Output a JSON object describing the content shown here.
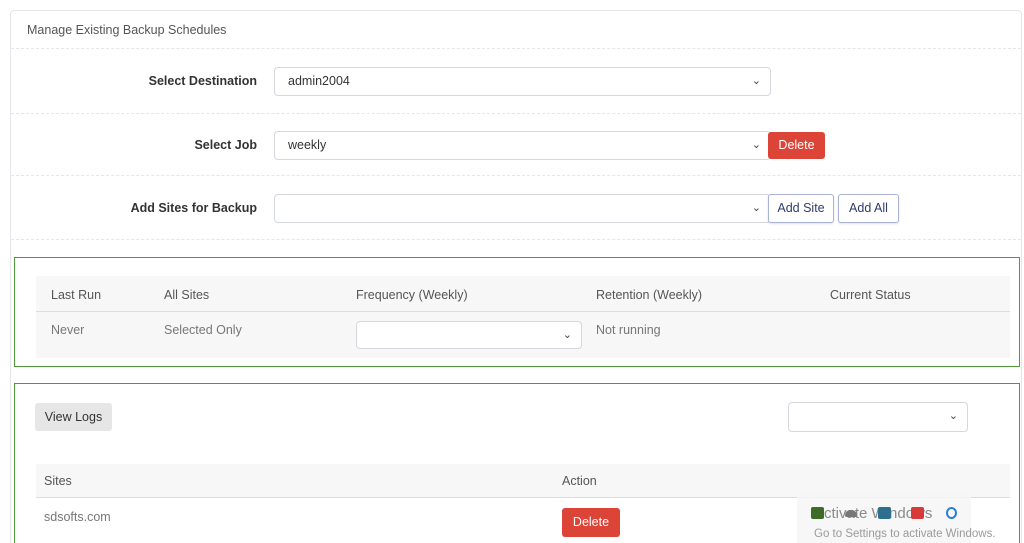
{
  "card": {
    "title": "Manage Existing Backup Schedules"
  },
  "destination": {
    "label": "Select Destination",
    "value": "admin2004"
  },
  "job": {
    "label": "Select Job",
    "value": "weekly",
    "delete_label": "Delete"
  },
  "sites": {
    "label": "Add Sites for Backup",
    "value": "",
    "add_site_label": "Add Site",
    "add_all_label": "Add All"
  },
  "schedule_table": {
    "headers": [
      "Last Run",
      "All Sites",
      "Frequency (Weekly)",
      "Retention (Weekly)",
      "Current Status"
    ],
    "row": {
      "last_run": "Never",
      "all_sites": "Selected Only",
      "frequency": "",
      "retention": "Not running",
      "status": ""
    }
  },
  "logs": {
    "view_logs_label": "View Logs",
    "select_value": ""
  },
  "sites_table": {
    "headers": [
      "Sites",
      "Action"
    ],
    "rows": [
      {
        "site": "sdsofts.com",
        "action_label": "Delete"
      }
    ]
  },
  "watermark": {
    "title": "Activate Windows",
    "subtitle": "Go to Settings to activate Windows."
  },
  "colors": {
    "danger": "#dc4438",
    "panel_border": "#4e9a3a",
    "outline_button_border": "#aab3d8"
  },
  "icons": {
    "select_arrow": "chevron-down-icon"
  }
}
